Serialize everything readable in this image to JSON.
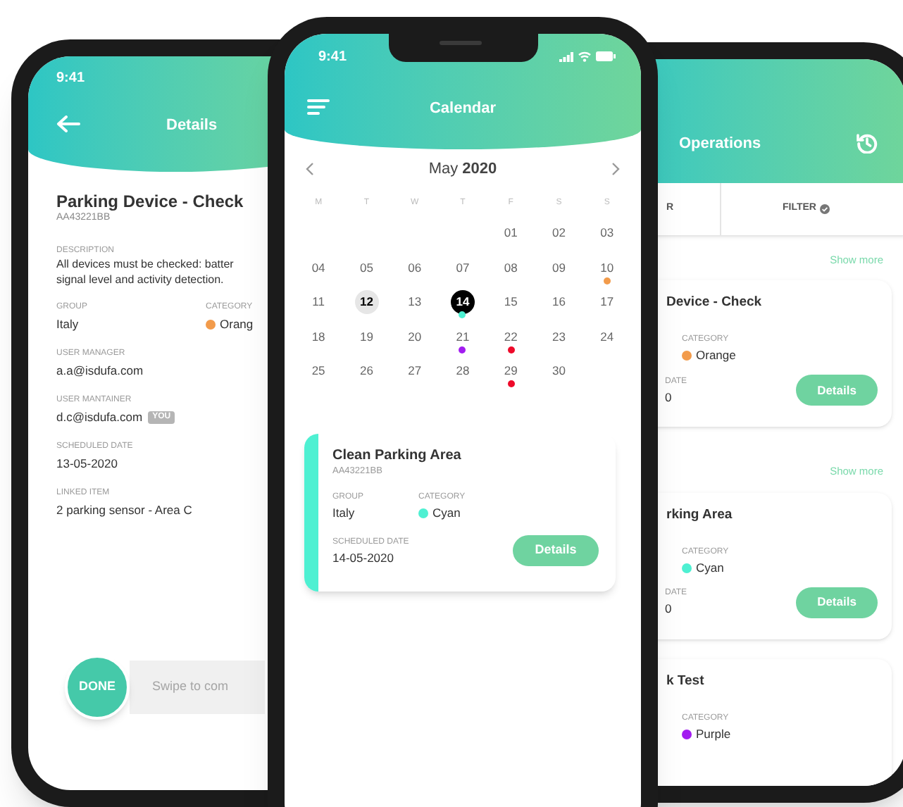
{
  "details_screen": {
    "status_time": "9:41",
    "title": "Details",
    "item_title": "Parking Device - Check",
    "item_code": "AA43221BB",
    "description": {
      "label": "DESCRIPTION",
      "lines": [
        "All devices must be checked: batter",
        "signal level and activity detection."
      ]
    },
    "group": {
      "label": "GROUP",
      "value": "Italy"
    },
    "category": {
      "label": "CATEGORY",
      "value": "Orang",
      "color": "#f29b4b"
    },
    "fields": [
      {
        "label": "USER MANAGER",
        "value": "a.a@isdufa.com"
      },
      {
        "label": "USER MANTAINER",
        "value": "d.c@isdufa.com",
        "badge": "YOU"
      },
      {
        "label": "SCHEDULED DATE",
        "value": "13-05-2020"
      },
      {
        "label": "LINKED ITEM",
        "value": "2 parking sensor - Area C"
      }
    ],
    "done_button": "DONE",
    "swipe_placeholder": "Swipe to com"
  },
  "calendar_screen": {
    "status_time": "9:41",
    "title": "Calendar",
    "month": "May **2020**",
    "weekdays": [
      "M",
      "T",
      "W",
      "T",
      "F",
      "S",
      "S"
    ],
    "weeks": [
      [
        {
          "kind": "blank"
        },
        {
          "kind": "blank"
        },
        {
          "kind": "blank"
        },
        {
          "kind": "blank"
        },
        {
          "kind": "day",
          "label": "01",
          "selected": false,
          "today": false
        },
        {
          "kind": "day",
          "label": "02",
          "selected": false,
          "today": false
        },
        {
          "kind": "day",
          "label": "03",
          "selected": false,
          "today": false
        }
      ],
      [
        {
          "kind": "day",
          "label": "04",
          "selected": false,
          "today": false
        },
        {
          "kind": "day",
          "label": "05",
          "selected": false,
          "today": false
        },
        {
          "kind": "day",
          "label": "06",
          "selected": false,
          "today": false
        },
        {
          "kind": "day",
          "label": "07",
          "selected": false,
          "today": false
        },
        {
          "kind": "day",
          "label": "08",
          "selected": false,
          "today": false
        },
        {
          "kind": "day",
          "label": "09",
          "selected": false,
          "today": false
        },
        {
          "kind": "day",
          "label": "10",
          "selected": false,
          "today": false,
          "color": "#f29b4b"
        }
      ],
      [
        {
          "kind": "day",
          "label": "11",
          "selected": false,
          "today": false
        },
        {
          "kind": "day",
          "label": "12",
          "selected": false,
          "today": true
        },
        {
          "kind": "day",
          "label": "13",
          "selected": false,
          "today": false
        },
        {
          "kind": "day",
          "label": "14",
          "selected": true,
          "today": false,
          "color": "#4ef0d2"
        },
        {
          "kind": "day",
          "label": "15",
          "selected": false,
          "today": false
        },
        {
          "kind": "day",
          "label": "16",
          "selected": false,
          "today": false
        },
        {
          "kind": "day",
          "label": "17",
          "selected": false,
          "today": false
        }
      ],
      [
        {
          "kind": "day",
          "label": "18",
          "selected": false,
          "today": false
        },
        {
          "kind": "day",
          "label": "19",
          "selected": false,
          "today": false
        },
        {
          "kind": "day",
          "label": "20",
          "selected": false,
          "today": false
        },
        {
          "kind": "day",
          "label": "21",
          "selected": false,
          "today": false,
          "color": "#a21cf0"
        },
        {
          "kind": "day",
          "label": "22",
          "selected": false,
          "today": false,
          "color": "#ee0a2a"
        },
        {
          "kind": "day",
          "label": "23",
          "selected": false,
          "today": false
        },
        {
          "kind": "day",
          "label": "24",
          "selected": false,
          "today": false
        }
      ],
      [
        {
          "kind": "day",
          "label": "25",
          "selected": false,
          "today": false
        },
        {
          "kind": "day",
          "label": "26",
          "selected": false,
          "today": false
        },
        {
          "kind": "day",
          "label": "27",
          "selected": false,
          "today": false
        },
        {
          "kind": "day",
          "label": "28",
          "selected": false,
          "today": false
        },
        {
          "kind": "day",
          "label": "29",
          "selected": false,
          "today": false,
          "color": "#ee0a2a"
        },
        {
          "kind": "day",
          "label": "30",
          "selected": false,
          "today": false
        },
        {
          "kind": "blank"
        }
      ]
    ],
    "event": {
      "title": "Clean Parking Area",
      "code": "AA43221BB",
      "group_label": "GROUP",
      "group_value": "Italy",
      "category_label": "CATEGORY",
      "category_value": "Cyan",
      "color": "#4ef0d2",
      "date_label": "SCHEDULED DATE",
      "date_value": "14-05-2020",
      "button": "Details"
    }
  },
  "operations_screen": {
    "title": "Operations",
    "tabs": [
      "R",
      "FILTER"
    ],
    "items": [
      {
        "kind": "link",
        "label": "Show more"
      },
      {
        "kind": "card",
        "title": "Device - Check",
        "category_label": "CATEGORY",
        "category_value": "Orange",
        "color": "#f29b4b",
        "date_label": "DATE",
        "date_value": "0",
        "button": "Details"
      },
      {
        "kind": "link",
        "label": "Show more"
      },
      {
        "kind": "card",
        "title": "rking Area",
        "category_label": "CATEGORY",
        "category_value": "Cyan",
        "color": "#4ef0d2",
        "date_label": "DATE",
        "date_value": "0",
        "button": "Details"
      },
      {
        "kind": "card",
        "title": "k Test",
        "category_label": "CATEGORY",
        "category_value": "Purple",
        "color": "#a21cf0"
      }
    ]
  }
}
